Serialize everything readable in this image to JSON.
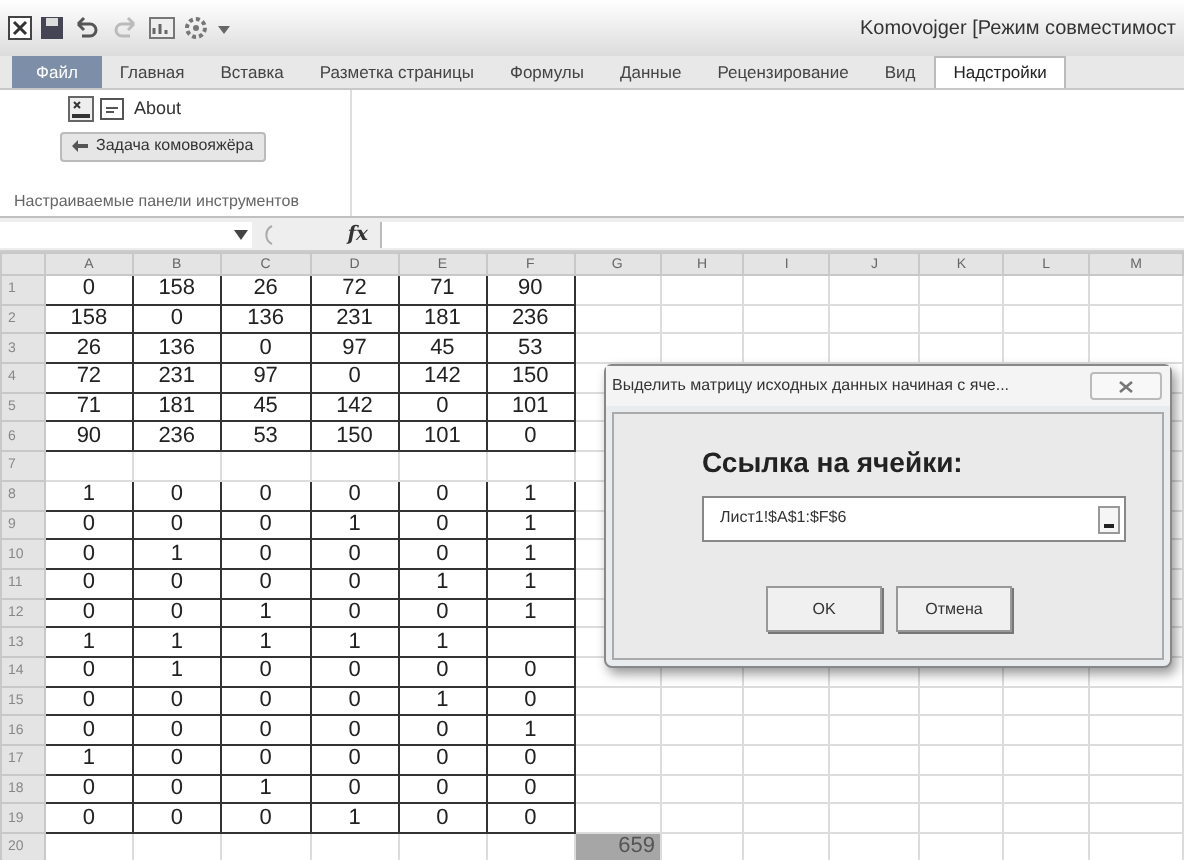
{
  "title_bar": {
    "title": "Komovojger [Режим совместимост"
  },
  "tabs": [
    {
      "label": "Файл",
      "kind": "file",
      "selected": false
    },
    {
      "label": "Главная",
      "kind": "tab",
      "selected": false
    },
    {
      "label": "Вставка",
      "kind": "tab",
      "selected": false
    },
    {
      "label": "Разметка страницы",
      "kind": "tab",
      "selected": false
    },
    {
      "label": "Формулы",
      "kind": "tab",
      "selected": false
    },
    {
      "label": "Данные",
      "kind": "tab",
      "selected": false
    },
    {
      "label": "Рецензирование",
      "kind": "tab",
      "selected": false
    },
    {
      "label": "Вид",
      "kind": "tab",
      "selected": false
    },
    {
      "label": "Надстройки",
      "kind": "tab",
      "selected": true
    }
  ],
  "ribbon": {
    "about": "About",
    "command": "Задача комовояжёра",
    "group_label": "Настраиваемые панели инструментов"
  },
  "formula_bar": {
    "fx": "fx"
  },
  "sheet": {
    "columns": [
      "A",
      "B",
      "C",
      "D",
      "E",
      "F",
      "G",
      "H",
      "I",
      "J",
      "K",
      "L",
      "M"
    ],
    "rows": [
      {
        "number": "1",
        "bordered": true,
        "values": {
          "A": "0",
          "B": "158",
          "C": "26",
          "D": "72",
          "E": "71",
          "F": "90"
        }
      },
      {
        "number": "2",
        "bordered": true,
        "values": {
          "A": "158",
          "B": "0",
          "C": "136",
          "D": "231",
          "E": "181",
          "F": "236"
        }
      },
      {
        "number": "3",
        "bordered": true,
        "values": {
          "A": "26",
          "B": "136",
          "C": "0",
          "D": "97",
          "E": "45",
          "F": "53"
        }
      },
      {
        "number": "4",
        "bordered": true,
        "values": {
          "A": "72",
          "B": "231",
          "C": "97",
          "D": "0",
          "E": "142",
          "F": "150"
        }
      },
      {
        "number": "5",
        "bordered": true,
        "values": {
          "A": "71",
          "B": "181",
          "C": "45",
          "D": "142",
          "E": "0",
          "F": "101"
        }
      },
      {
        "number": "6",
        "bordered": true,
        "values": {
          "A": "90",
          "B": "236",
          "C": "53",
          "D": "150",
          "E": "101",
          "F": "0"
        }
      },
      {
        "number": "7",
        "bordered": false,
        "values": {}
      },
      {
        "number": "8",
        "bordered": true,
        "values": {
          "A": "1",
          "B": "0",
          "C": "0",
          "D": "0",
          "E": "0",
          "F": "1"
        }
      },
      {
        "number": "9",
        "bordered": true,
        "values": {
          "A": "0",
          "B": "0",
          "C": "0",
          "D": "1",
          "E": "0",
          "F": "1"
        }
      },
      {
        "number": "10",
        "bordered": true,
        "values": {
          "A": "0",
          "B": "1",
          "C": "0",
          "D": "0",
          "E": "0",
          "F": "1"
        }
      },
      {
        "number": "11",
        "bordered": true,
        "values": {
          "A": "0",
          "B": "0",
          "C": "0",
          "D": "0",
          "E": "1",
          "F": "1"
        }
      },
      {
        "number": "12",
        "bordered": true,
        "values": {
          "A": "0",
          "B": "0",
          "C": "1",
          "D": "0",
          "E": "0",
          "F": "1"
        }
      },
      {
        "number": "13",
        "bordered": true,
        "values": {
          "A": "1",
          "B": "1",
          "C": "1",
          "D": "1",
          "E": "1"
        }
      },
      {
        "number": "14",
        "bordered": true,
        "values": {
          "A": "0",
          "B": "1",
          "C": "0",
          "D": "0",
          "E": "0",
          "F": "0"
        }
      },
      {
        "number": "15",
        "bordered": true,
        "values": {
          "A": "0",
          "B": "0",
          "C": "0",
          "D": "0",
          "E": "1",
          "F": "0"
        }
      },
      {
        "number": "16",
        "bordered": true,
        "values": {
          "A": "0",
          "B": "0",
          "C": "0",
          "D": "0",
          "E": "0",
          "F": "1"
        }
      },
      {
        "number": "17",
        "bordered": true,
        "values": {
          "A": "1",
          "B": "0",
          "C": "0",
          "D": "0",
          "E": "0",
          "F": "0"
        }
      },
      {
        "number": "18",
        "bordered": true,
        "values": {
          "A": "0",
          "B": "0",
          "C": "1",
          "D": "0",
          "E": "0",
          "F": "0"
        }
      },
      {
        "number": "19",
        "bordered": true,
        "values": {
          "A": "0",
          "B": "0",
          "C": "0",
          "D": "1",
          "E": "0",
          "F": "0"
        }
      },
      {
        "number": "20",
        "bordered": false,
        "values": {
          "G": "659"
        },
        "selected": {
          "G": true
        }
      }
    ]
  },
  "dialog": {
    "title": "Выделить матрицу исходных данных начиная с яче...",
    "heading": "Ссылка на ячейки:",
    "field_value": "Лист1!$A$1:$F$6",
    "buttons": [
      "OK",
      "Отмена"
    ]
  }
}
